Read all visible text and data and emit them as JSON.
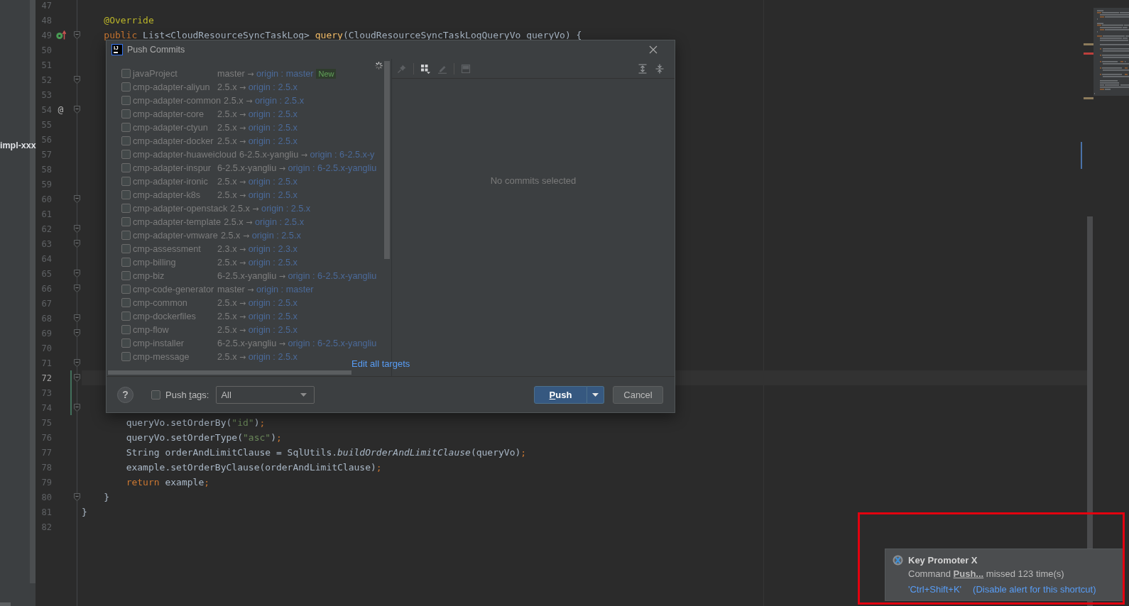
{
  "project_panel": {
    "item": "impl-xxx"
  },
  "editor": {
    "lines": [
      {
        "number": "47",
        "current": false,
        "changed": false,
        "fold": false
      },
      {
        "number": "48",
        "current": false,
        "changed": false,
        "fold": false,
        "code": [
          {
            "text": "    @Override",
            "kind": "annotation"
          }
        ]
      },
      {
        "number": "49",
        "current": false,
        "changed": false,
        "fold": true,
        "gutter_icon": {
          "kind": "implements"
        },
        "code": [
          {
            "text": "    public",
            "kind": "keyword"
          },
          {
            "text": " List<CloudResourceSyncTaskLog> ",
            "kind": "plain"
          },
          {
            "text": "query",
            "kind": "method"
          },
          {
            "text": "(CloudResourceSyncTaskLogQueryVo queryVo) {",
            "kind": "plain"
          }
        ]
      },
      {
        "number": "50",
        "current": false,
        "changed": false,
        "fold": false
      },
      {
        "number": "51",
        "current": false,
        "changed": false,
        "fold": false
      },
      {
        "number": "52",
        "current": false,
        "changed": false,
        "fold": true
      },
      {
        "number": "53",
        "current": false,
        "changed": false,
        "fold": false
      },
      {
        "number": "54",
        "current": false,
        "changed": false,
        "fold": true,
        "gutter_mark": "@"
      },
      {
        "number": "55",
        "current": false,
        "changed": false,
        "fold": false
      },
      {
        "number": "56",
        "current": false,
        "changed": false,
        "fold": false
      },
      {
        "number": "57",
        "current": false,
        "changed": false,
        "fold": false
      },
      {
        "number": "58",
        "current": false,
        "changed": false,
        "fold": false
      },
      {
        "number": "59",
        "current": false,
        "changed": false,
        "fold": false
      },
      {
        "number": "60",
        "current": false,
        "changed": false,
        "fold": true
      },
      {
        "number": "61",
        "current": false,
        "changed": false,
        "fold": false
      },
      {
        "number": "62",
        "current": false,
        "changed": false,
        "fold": true
      },
      {
        "number": "63",
        "current": false,
        "changed": false,
        "fold": true
      },
      {
        "number": "64",
        "current": false,
        "changed": false,
        "fold": false
      },
      {
        "number": "65",
        "current": false,
        "changed": false,
        "fold": true
      },
      {
        "number": "66",
        "current": false,
        "changed": false,
        "fold": true
      },
      {
        "number": "67",
        "current": false,
        "changed": false,
        "fold": false
      },
      {
        "number": "68",
        "current": false,
        "changed": false,
        "fold": true
      },
      {
        "number": "69",
        "current": false,
        "changed": false,
        "fold": true
      },
      {
        "number": "70",
        "current": false,
        "changed": false,
        "fold": false
      },
      {
        "number": "71",
        "current": false,
        "changed": false,
        "fold": true
      },
      {
        "number": "72",
        "current": true,
        "changed": true,
        "fold": true
      },
      {
        "number": "73",
        "current": false,
        "changed": true,
        "fold": false
      },
      {
        "number": "74",
        "current": false,
        "changed": true,
        "fold": true
      },
      {
        "number": "75",
        "current": false,
        "changed": false,
        "fold": false,
        "code": [
          {
            "text": "        queryVo.setOrderBy(",
            "kind": "plain"
          },
          {
            "text": "\"id\"",
            "kind": "string"
          },
          {
            "text": ")",
            "kind": "plain"
          },
          {
            "text": ";",
            "kind": "keyword"
          }
        ]
      },
      {
        "number": "76",
        "current": false,
        "changed": false,
        "fold": false,
        "code": [
          {
            "text": "        queryVo.setOrderType(",
            "kind": "plain"
          },
          {
            "text": "\"asc\"",
            "kind": "string"
          },
          {
            "text": ")",
            "kind": "plain"
          },
          {
            "text": ";",
            "kind": "keyword"
          }
        ]
      },
      {
        "number": "77",
        "current": false,
        "changed": false,
        "fold": false,
        "code": [
          {
            "text": "        String orderAndLimitClause = SqlUtils.",
            "kind": "plain"
          },
          {
            "text": "buildOrderAndLimitClause",
            "kind": "static"
          },
          {
            "text": "(queryVo)",
            "kind": "plain"
          },
          {
            "text": ";",
            "kind": "keyword"
          }
        ]
      },
      {
        "number": "78",
        "current": false,
        "changed": false,
        "fold": false,
        "code": [
          {
            "text": "        example.setOrderByClause(orderAndLimitClause)",
            "kind": "plain"
          },
          {
            "text": ";",
            "kind": "keyword"
          }
        ]
      },
      {
        "number": "79",
        "current": false,
        "changed": false,
        "fold": false,
        "code": [
          {
            "text": "        return",
            "kind": "keyword"
          },
          {
            "text": " example",
            "kind": "plain"
          },
          {
            "text": ";",
            "kind": "keyword"
          }
        ]
      },
      {
        "number": "80",
        "current": false,
        "changed": false,
        "fold": true,
        "code": [
          {
            "text": "    }",
            "kind": "plain"
          }
        ]
      },
      {
        "number": "81",
        "current": false,
        "changed": false,
        "fold": false,
        "code": [
          {
            "text": "}",
            "kind": "plain"
          }
        ]
      },
      {
        "number": "82",
        "current": false,
        "changed": false,
        "fold": false
      }
    ]
  },
  "dialog": {
    "logo": "IJ",
    "title": "Push Commits",
    "repositories": [
      {
        "name": "javaProject",
        "checked": false,
        "source": "master",
        "arrow": "→",
        "target": "origin : master",
        "badge": "New"
      },
      {
        "name": "cmp-adapter-aliyun",
        "checked": false,
        "source": "2.5.x",
        "arrow": "→",
        "target": "origin : 2.5.x"
      },
      {
        "name": "cmp-adapter-common",
        "checked": false,
        "source": "2.5.x",
        "arrow": "→",
        "target": "origin : 2.5.x"
      },
      {
        "name": "cmp-adapter-core",
        "checked": false,
        "source": "2.5.x",
        "arrow": "→",
        "target": "origin : 2.5.x"
      },
      {
        "name": "cmp-adapter-ctyun",
        "checked": false,
        "source": "2.5.x",
        "arrow": "→",
        "target": "origin : 2.5.x"
      },
      {
        "name": "cmp-adapter-docker",
        "checked": false,
        "source": "2.5.x",
        "arrow": "→",
        "target": "origin : 2.5.x"
      },
      {
        "name": "cmp-adapter-huaweicloud",
        "checked": false,
        "source": "6-2.5.x-yangliu",
        "arrow": "→",
        "target": "origin : 6-2.5.x-y"
      },
      {
        "name": "cmp-adapter-inspur",
        "checked": false,
        "source": "6-2.5.x-yangliu",
        "arrow": "→",
        "target": "origin : 6-2.5.x-yangliu"
      },
      {
        "name": "cmp-adapter-ironic",
        "checked": false,
        "source": "2.5.x",
        "arrow": "→",
        "target": "origin : 2.5.x"
      },
      {
        "name": "cmp-adapter-k8s",
        "checked": false,
        "source": "2.5.x",
        "arrow": "→",
        "target": "origin : 2.5.x"
      },
      {
        "name": "cmp-adapter-openstack",
        "checked": false,
        "source": "2.5.x",
        "arrow": "→",
        "target": "origin : 2.5.x"
      },
      {
        "name": "cmp-adapter-template",
        "checked": false,
        "source": "2.5.x",
        "arrow": "→",
        "target": "origin : 2.5.x"
      },
      {
        "name": "cmp-adapter-vmware",
        "checked": false,
        "source": "2.5.x",
        "arrow": "→",
        "target": "origin : 2.5.x"
      },
      {
        "name": "cmp-assessment",
        "checked": false,
        "source": "2.3.x",
        "arrow": "→",
        "target": "origin : 2.3.x"
      },
      {
        "name": "cmp-billing",
        "checked": false,
        "source": "2.5.x",
        "arrow": "→",
        "target": "origin : 2.5.x"
      },
      {
        "name": "cmp-biz",
        "checked": false,
        "source": "6-2.5.x-yangliu",
        "arrow": "→",
        "target": "origin : 6-2.5.x-yangliu"
      },
      {
        "name": "cmp-code-generator",
        "checked": false,
        "source": "master",
        "arrow": "→",
        "target": "origin : master"
      },
      {
        "name": "cmp-common",
        "checked": false,
        "source": "2.5.x",
        "arrow": "→",
        "target": "origin : 2.5.x"
      },
      {
        "name": "cmp-dockerfiles",
        "checked": false,
        "source": "2.5.x",
        "arrow": "→",
        "target": "origin : 2.5.x"
      },
      {
        "name": "cmp-flow",
        "checked": false,
        "source": "2.5.x",
        "arrow": "→",
        "target": "origin : 2.5.x"
      },
      {
        "name": "cmp-installer",
        "checked": false,
        "source": "6-2.5.x-yangliu",
        "arrow": "→",
        "target": "origin : 6-2.5.x-yangliu"
      },
      {
        "name": "cmp-message",
        "checked": false,
        "source": "2.5.x",
        "arrow": "→",
        "target": "origin : 2.5.x"
      }
    ],
    "edit_link": "Edit all targets",
    "toolbar": {
      "left_groups": [
        [
          {
            "kind": "pin",
            "disabled": true
          }
        ],
        [
          {
            "kind": "grid",
            "disabled": false
          },
          {
            "kind": "pencil",
            "disabled": true
          }
        ],
        [
          {
            "kind": "layout",
            "disabled": true
          }
        ]
      ],
      "right": [
        {
          "kind": "expand",
          "disabled": false
        },
        {
          "kind": "collapse",
          "disabled": false
        }
      ]
    },
    "empty_message": "No commits selected",
    "help": "?",
    "push_tags": {
      "checked": false,
      "label": [
        {
          "text": "Push ",
          "underlined": false
        },
        {
          "text": "t",
          "underlined": true
        },
        {
          "text": "ags:",
          "underlined": false
        }
      ],
      "value": "All"
    },
    "buttons": [
      {
        "label": [
          {
            "text": "P",
            "underlined": true
          },
          {
            "text": "ush",
            "underlined": false
          }
        ],
        "default": true,
        "menu": true
      },
      {
        "label": [
          {
            "text": "Cancel",
            "underlined": false
          }
        ],
        "default": false,
        "menu": false
      }
    ]
  },
  "notification": {
    "title": "Key Promoter X",
    "message": "Command **Push...** missed 123 time(s)",
    "links": [
      "'Ctrl+Shift+K'",
      "(Disable alert for this shortcut)"
    ]
  },
  "annotation": {
    "kind": "rectangle"
  }
}
